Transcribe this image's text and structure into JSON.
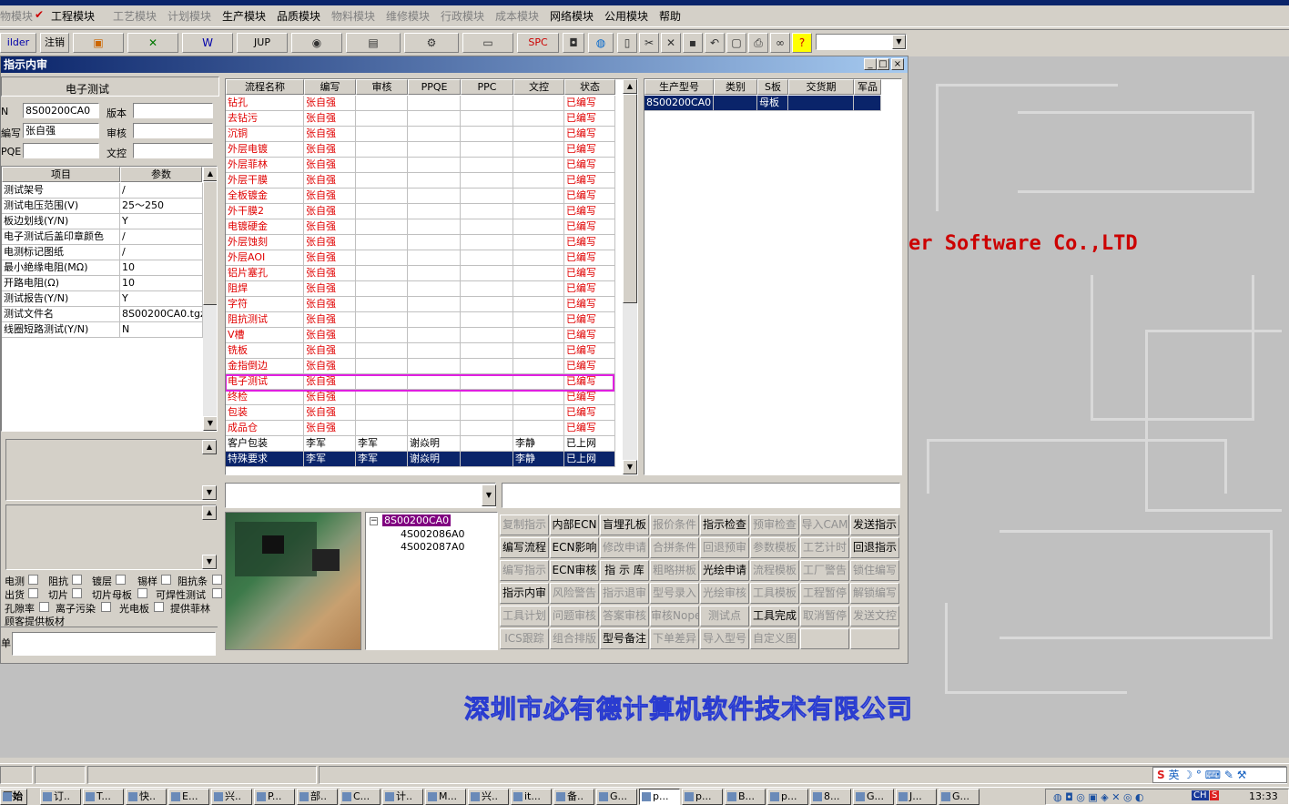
{
  "menu": [
    "物模块",
    "工程模块",
    "工艺模块",
    "计划模块",
    "生产模块",
    "品质模块",
    "物料模块",
    "维修模块",
    "行政模块",
    "成本模块",
    "网络模块",
    "公用模块",
    "帮助"
  ],
  "toolbar": {
    "builder": "ilder",
    "logout": "注销",
    "jup": "JUP",
    "spc": "SPC",
    "combo": ""
  },
  "window": {
    "title": "指示内审",
    "minimize": "_",
    "restore": "□",
    "close": "×"
  },
  "left": {
    "section_title": "电子测试",
    "f_no_label": "N",
    "f_no_value": "8S00200CA0",
    "f_ver_label": "版本",
    "f_ver_value": "",
    "f_writer_label": "編写",
    "f_writer_value": "张自强",
    "f_audit_label": "审核",
    "f_audit_value": "",
    "f_ppqe_label": "PQE",
    "f_ppqe_value": "",
    "f_doc_label": "文控",
    "f_doc_value": "",
    "param_headers": [
      "项目",
      "参数"
    ],
    "params": [
      [
        "测试架号",
        "/"
      ],
      [
        "测试电压范围(V)",
        "25～250"
      ],
      [
        "板边划线(Y/N)",
        "Y"
      ],
      [
        "电子测试后盖印章颜色",
        "/"
      ],
      [
        "电测标记图纸",
        "/"
      ],
      [
        "最小絶缘电阻(MΩ)",
        "10"
      ],
      [
        "开路电阻(Ω)",
        "10"
      ],
      [
        "测试报告(Y/N)",
        "Y"
      ],
      [
        "测试文件名",
        "8S00200CA0.tgz"
      ],
      [
        "线圈短路测试(Y/N)",
        "N"
      ]
    ],
    "checks": [
      [
        "电测",
        "阻抗",
        "镀层",
        "锡样",
        "阻抗条"
      ],
      [
        "出货",
        "切片",
        "切片母板",
        "可焊性测试"
      ],
      [
        "孔隙率",
        "离子污染",
        "光电板",
        "提供菲林"
      ]
    ],
    "customer_board": "顾客提供板材",
    "bottom_label": "单"
  },
  "flow": {
    "headers": [
      "流程名称",
      "编写",
      "审核",
      "PPQE",
      "PPC",
      "文控",
      "状态"
    ],
    "rows": [
      [
        "钻孔",
        "张自强",
        "",
        "",
        "",
        "",
        "已编写"
      ],
      [
        "去钻污",
        "张自强",
        "",
        "",
        "",
        "",
        "已编写"
      ],
      [
        "沉铜",
        "张自强",
        "",
        "",
        "",
        "",
        "已编写"
      ],
      [
        "外层电镀",
        "张自强",
        "",
        "",
        "",
        "",
        "已编写"
      ],
      [
        "外层菲林",
        "张自强",
        "",
        "",
        "",
        "",
        "已编写"
      ],
      [
        "外层干膜",
        "张自强",
        "",
        "",
        "",
        "",
        "已编写"
      ],
      [
        "全板镀金",
        "张自强",
        "",
        "",
        "",
        "",
        "已编写"
      ],
      [
        "外干膜2",
        "张自强",
        "",
        "",
        "",
        "",
        "已编写"
      ],
      [
        "电镀硬金",
        "张自强",
        "",
        "",
        "",
        "",
        "已编写"
      ],
      [
        "外层蚀刻",
        "张自强",
        "",
        "",
        "",
        "",
        "已编写"
      ],
      [
        "外层AOI",
        "张自强",
        "",
        "",
        "",
        "",
        "已编写"
      ],
      [
        "铝片塞孔",
        "张自强",
        "",
        "",
        "",
        "",
        "已编写"
      ],
      [
        "阻焊",
        "张自强",
        "",
        "",
        "",
        "",
        "已编写"
      ],
      [
        "字符",
        "张自强",
        "",
        "",
        "",
        "",
        "已编写"
      ],
      [
        "阻抗测试",
        "张自强",
        "",
        "",
        "",
        "",
        "已编写"
      ],
      [
        "V槽",
        "张自强",
        "",
        "",
        "",
        "",
        "已编写"
      ],
      [
        "铣板",
        "张自强",
        "",
        "",
        "",
        "",
        "已编写"
      ],
      [
        "金指倒边",
        "张自强",
        "",
        "",
        "",
        "",
        "已编写"
      ],
      [
        "电子测试",
        "张自强",
        "",
        "",
        "",
        "",
        "已编写"
      ],
      [
        "终检",
        "张自强",
        "",
        "",
        "",
        "",
        "已编写"
      ],
      [
        "包装",
        "张自强",
        "",
        "",
        "",
        "",
        "已编写"
      ],
      [
        "成品仓",
        "张自强",
        "",
        "",
        "",
        "",
        "已编写"
      ],
      [
        "客户包装",
        "李军",
        "李军",
        "谢焱明",
        "",
        "李静",
        "已上网"
      ],
      [
        "特殊要求",
        "李军",
        "李军",
        "谢焱明",
        "",
        "李静",
        "已上网"
      ]
    ]
  },
  "models": {
    "headers": [
      "生产型号",
      "类别",
      "S板",
      "交货期",
      "军品"
    ],
    "rows": [
      [
        "8S00200CA0",
        "",
        "母板",
        "",
        ""
      ]
    ]
  },
  "tree": {
    "root": "8S00200CA0",
    "children": [
      "4S002086A0",
      "4S002087A0"
    ]
  },
  "actions": [
    [
      [
        "复制指示",
        false
      ],
      [
        "内部ECN",
        true
      ],
      [
        "盲埋孔板",
        true
      ],
      [
        "报价条件",
        false
      ],
      [
        "指示检查",
        true
      ],
      [
        "预审检查",
        false
      ],
      [
        "导入CAM",
        false
      ],
      [
        "发送指示",
        true
      ]
    ],
    [
      [
        "编写流程",
        true
      ],
      [
        "ECN影响",
        true
      ],
      [
        "修改申请",
        false
      ],
      [
        "合拼条件",
        false
      ],
      [
        "回退预审",
        false
      ],
      [
        "参数模板",
        false
      ],
      [
        "工艺计时",
        false
      ],
      [
        "回退指示",
        true
      ]
    ],
    [
      [
        "编写指示",
        false
      ],
      [
        "ECN审核",
        true
      ],
      [
        "指 示 库",
        true
      ],
      [
        "粗略拼板",
        false
      ],
      [
        "光绘申请",
        true
      ],
      [
        "流程模板",
        false
      ],
      [
        "工厂警告",
        false
      ],
      [
        "锁住编写",
        false
      ]
    ],
    [
      [
        "指示内审",
        true
      ],
      [
        "风险警告",
        false
      ],
      [
        "指示退审",
        false
      ],
      [
        "型号录入",
        false
      ],
      [
        "光绘审核",
        false
      ],
      [
        "工具模板",
        false
      ],
      [
        "工程暂停",
        false
      ],
      [
        "解锁编写",
        false
      ]
    ],
    [
      [
        "工具计划",
        false
      ],
      [
        "问题审核",
        false
      ],
      [
        "答案审核",
        false
      ],
      [
        "审核Nope",
        false
      ],
      [
        "测试点",
        false
      ],
      [
        "工具完成",
        true
      ],
      [
        "取消暂停",
        false
      ],
      [
        "发送文控",
        false
      ]
    ],
    [
      [
        "ICS跟踪",
        false
      ],
      [
        "组合排版",
        false
      ],
      [
        "型号备注",
        true
      ],
      [
        "下单差异",
        false
      ],
      [
        "导入型号",
        false
      ],
      [
        "自定义图",
        false
      ],
      [
        "",
        false
      ],
      [
        "",
        false
      ]
    ]
  ],
  "desktop": {
    "software": "er Software Co.,LTD",
    "company": "深圳市必有德计算机软件技术有限公司"
  },
  "taskbar": {
    "start": "开始",
    "items": [
      "订..",
      "T...",
      "快..",
      "E...",
      "兴..",
      "P...",
      "部..",
      "C...",
      "计..",
      "M...",
      "兴..",
      "it...",
      "备..",
      "G...",
      "p...",
      "p...",
      "B...",
      "p...",
      "8...",
      "G...",
      "J...",
      "G..."
    ],
    "ime": "英",
    "clock": "13:33"
  },
  "colors": {
    "title": "#0a246a",
    "red": "#e00000",
    "highlight": "#e020e0"
  }
}
